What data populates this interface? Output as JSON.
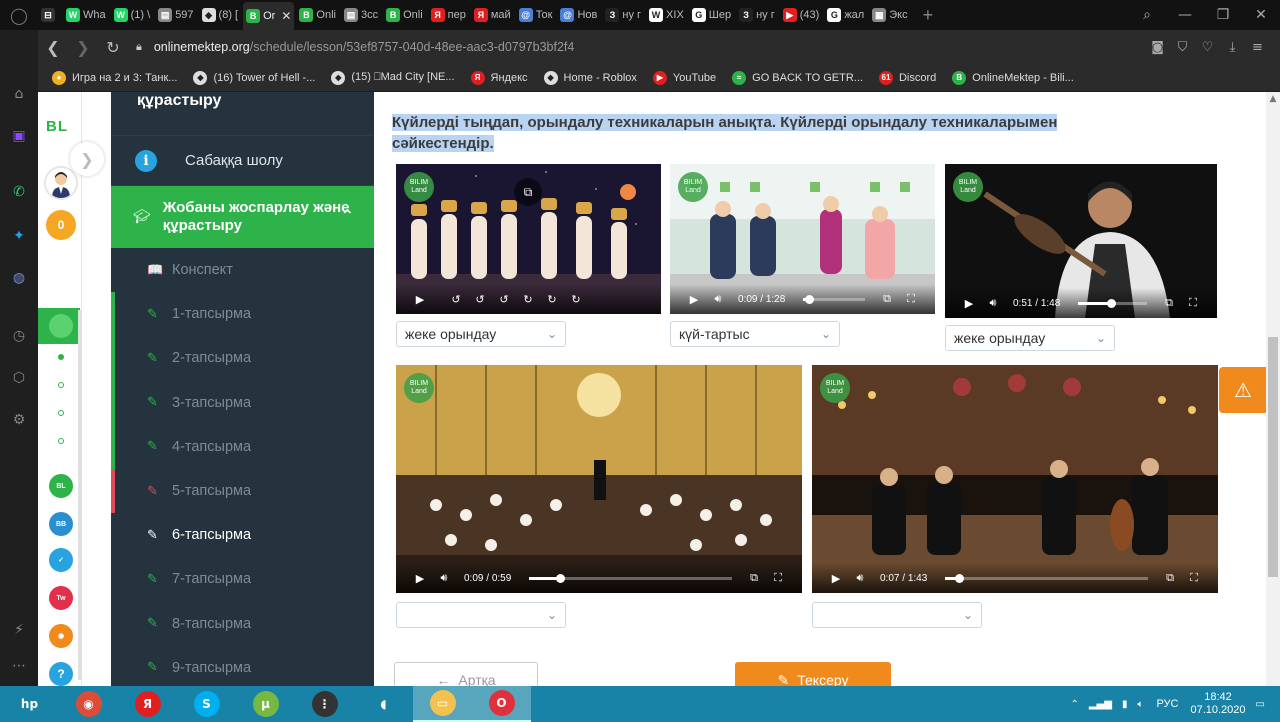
{
  "browser": {
    "tabs": [
      {
        "label": "",
        "color": "#333333",
        "glyph": "⊟"
      },
      {
        "label": "Wha",
        "color": "#25d366",
        "glyph": "W"
      },
      {
        "label": "(1) \\",
        "color": "#25d366",
        "glyph": "W"
      },
      {
        "label": "597",
        "color": "#888888",
        "glyph": "▤"
      },
      {
        "label": "(8) [",
        "color": "#dddddd",
        "glyph": "◆"
      },
      {
        "label": "Or",
        "color": "#2db34a",
        "glyph": "B",
        "active": true
      },
      {
        "label": "Onli",
        "color": "#2db34a",
        "glyph": "B"
      },
      {
        "label": "3сс",
        "color": "#888888",
        "glyph": "▤"
      },
      {
        "label": "Onli",
        "color": "#2db34a",
        "glyph": "B"
      },
      {
        "label": "пер",
        "color": "#e02020",
        "glyph": "Я"
      },
      {
        "label": "май",
        "color": "#e02020",
        "glyph": "Я"
      },
      {
        "label": "Ток",
        "color": "#4a7fd8",
        "glyph": "@"
      },
      {
        "label": "Нов",
        "color": "#4a7fd8",
        "glyph": "@"
      },
      {
        "label": "ну г",
        "color": "#222222",
        "glyph": "З"
      },
      {
        "label": "XIX",
        "color": "#ffffff",
        "glyph": "W"
      },
      {
        "label": "Шер",
        "color": "#ffffff",
        "glyph": "G"
      },
      {
        "label": "ну г",
        "color": "#222222",
        "glyph": "З"
      },
      {
        "label": "(43)",
        "color": "#e02020",
        "glyph": "▶"
      },
      {
        "label": "жал",
        "color": "#ffffff",
        "glyph": "G"
      },
      {
        "label": "Экс",
        "color": "#888888",
        "glyph": "▦"
      }
    ],
    "url_host": "onlinemektep.org",
    "url_path": "/schedule/lesson/53ef8757-040d-48ee-aac3-d0797b3bf2f4",
    "bookmarks": [
      {
        "label": "Игра на 2 и 3: Танк...",
        "color": "#f0b020",
        "glyph": "●"
      },
      {
        "label": "(16) Tower of Hell -...",
        "color": "#dddddd",
        "glyph": "◆"
      },
      {
        "label": "(15) ⎕Mad City [NE...",
        "color": "#dddddd",
        "glyph": "◆"
      },
      {
        "label": "Яндекс",
        "color": "#e02020",
        "glyph": "Я"
      },
      {
        "label": "Home - Roblox",
        "color": "#dddddd",
        "glyph": "◆"
      },
      {
        "label": "YouTube",
        "color": "#e02020",
        "glyph": "▶"
      },
      {
        "label": "GO BACK TO GETR...",
        "color": "#2db34a",
        "glyph": "≈"
      },
      {
        "label": "Discord",
        "color": "#e02020",
        "glyph": "61"
      },
      {
        "label": "OnlineMektep - Bili...",
        "color": "#2db34a",
        "glyph": "B"
      }
    ]
  },
  "rail": {
    "logo": "BL",
    "coins": "0"
  },
  "lesson_nav": {
    "top_title": "құрастыру",
    "overview": "Сабаққа шолу",
    "section": "Жобаны жоспарлау және құрастыру",
    "items": [
      {
        "label": "Конспект",
        "state": "plain",
        "icon": "book-icon",
        "glyph": "📖"
      },
      {
        "label": "1-тапсырма",
        "state": "done",
        "icon": "edit-icon",
        "glyph": "✎"
      },
      {
        "label": "2-тапсырма",
        "state": "done",
        "icon": "edit-icon",
        "glyph": "✎"
      },
      {
        "label": "3-тапсырма",
        "state": "done",
        "icon": "edit-icon",
        "glyph": "✎"
      },
      {
        "label": "4-тапсырма",
        "state": "done",
        "icon": "edit-icon",
        "glyph": "✎"
      },
      {
        "label": "5-тапсырма",
        "state": "fail",
        "icon": "edit-icon",
        "glyph": "✎"
      },
      {
        "label": "6-тапсырма",
        "state": "current",
        "icon": "edit-icon",
        "glyph": "✎"
      },
      {
        "label": "7-тапсырма",
        "state": "todo",
        "icon": "edit-icon",
        "glyph": "✎"
      },
      {
        "label": "8-тапсырма",
        "state": "todo",
        "icon": "edit-icon",
        "glyph": "✎"
      },
      {
        "label": "9-тапсырма",
        "state": "todo",
        "icon": "edit-icon",
        "glyph": "✎"
      }
    ]
  },
  "task": {
    "question": "Күйлерді тыңдап, орындалу техникаларын анықта. Күйлерді орындалу техникаларымен сәйкестендір.",
    "videos": [
      {
        "current": "",
        "duration": "",
        "progress": 0,
        "selected": "жеке орындау"
      },
      {
        "current": "0:09",
        "duration": "1:28",
        "progress": 0.1,
        "selected": "күй-тартыс"
      },
      {
        "current": "0:51",
        "duration": "1:48",
        "progress": 0.47,
        "selected": "жеке орындау"
      },
      {
        "current": "0:09",
        "duration": "0:59",
        "progress": 0.15,
        "selected": ""
      },
      {
        "current": "0:07",
        "duration": "1:43",
        "progress": 0.07,
        "selected": ""
      }
    ],
    "badge_text": "BILIM Land",
    "back_label": "Артқа",
    "check_label": "Тексеру"
  },
  "taskbar": {
    "apps": [
      {
        "name": "hp",
        "color": "#1883a6",
        "glyph": "hp"
      },
      {
        "name": "chrome",
        "color": "#dd4b39",
        "glyph": "◉"
      },
      {
        "name": "yandex",
        "color": "#e02020",
        "glyph": "Я"
      },
      {
        "name": "skype",
        "color": "#00aff0",
        "glyph": "S"
      },
      {
        "name": "utorrent",
        "color": "#77b843",
        "glyph": "µ"
      },
      {
        "name": "traffic",
        "color": "#333333",
        "glyph": "⋮"
      },
      {
        "name": "mouse",
        "color": "#1883a6",
        "glyph": "◖"
      },
      {
        "name": "explorer",
        "color": "#f2c14e",
        "glyph": "▭",
        "on": true
      },
      {
        "name": "opera",
        "color": "#e0303a",
        "glyph": "O",
        "on": true
      }
    ],
    "lang": "РУС",
    "time": "18:42",
    "date": "07.10.2020"
  }
}
